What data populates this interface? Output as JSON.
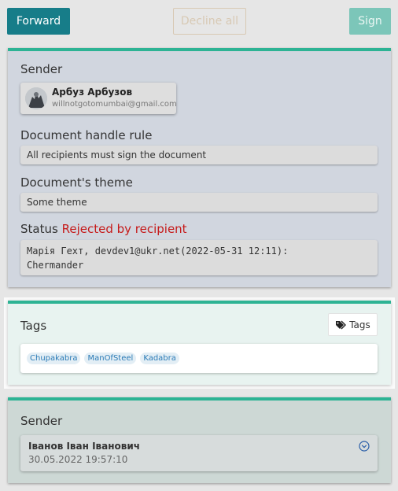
{
  "toolbar": {
    "forward_label": "Forward",
    "decline_label": "Decline all",
    "sign_label": "Sign"
  },
  "document": {
    "sender_heading": "Sender",
    "sender": {
      "name": "Арбуз Арбузов",
      "email": "willnotgotomumbai@gmail.com",
      "avatar_icon": "user-avatar"
    },
    "handle_rule_heading": "Document handle rule",
    "handle_rule_value": "All recipients must sign the document",
    "theme_heading": "Document's theme",
    "theme_value": "Some theme",
    "status_label": "Status",
    "status_value": "Rejected by recipient",
    "rejection_comment": "Марія Гехт, devdev1@ukr.net(2022-05-31 12:11):\nChermander"
  },
  "tags_panel": {
    "heading": "Tags",
    "button_label": "Tags",
    "button_icon": "tags-icon",
    "tags": [
      "Chupakabra",
      "ManOfSteel",
      "Kadabra"
    ]
  },
  "history": {
    "heading": "Sender",
    "entry": {
      "name": "Іванов Іван Іванович",
      "date": "30.05.2022 19:57:10",
      "toggle_icon": "chevron-down-circle-icon"
    }
  },
  "colors": {
    "accent": "#2db394",
    "forward": "#177d89",
    "status_rejected": "#c61a1a",
    "tag_text": "#2b7bb6"
  }
}
